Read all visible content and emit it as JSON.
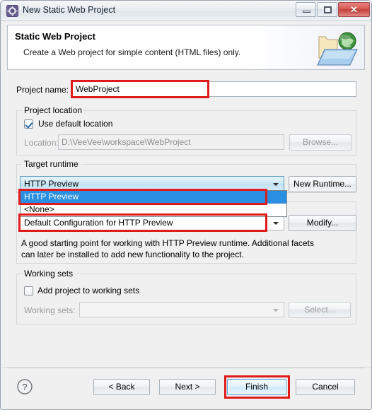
{
  "window": {
    "title": "New Static Web Project",
    "icon": "eclipse-wizard-icon",
    "controls": {
      "minimize": "minimize-button",
      "maximize": "maximize-button",
      "close_glyph": "✕"
    }
  },
  "header": {
    "title": "Static Web Project",
    "description": "Create a Web project for simple content (HTML files) only.",
    "icon": "web-project-folder-globe-icon"
  },
  "project_name": {
    "label": "Project name:",
    "value": "WebProject",
    "placeholder": "",
    "highlighted": true
  },
  "project_location": {
    "group_label": "Project location",
    "use_default_checkbox": {
      "label": "Use default location",
      "checked": true
    },
    "location": {
      "label": "Location:",
      "value": "D:\\VeeVee\\workspace\\WebProject",
      "disabled": true
    },
    "browse_button": "Browse..."
  },
  "target_runtime": {
    "group_label": "Target runtime",
    "selected": "HTTP Preview",
    "open": true,
    "options": [
      {
        "label": "HTTP Preview",
        "selected": true
      },
      {
        "label": "<None>",
        "selected": false
      }
    ],
    "new_runtime_button": "New Runtime...",
    "highlighted": true
  },
  "configuration": {
    "selected": "Default Configuration for HTTP Preview",
    "modify_button": "Modify...",
    "description": "A good starting point for working with HTTP Preview runtime. Additional facets can later be installed to add new functionality to the project.",
    "highlighted": true
  },
  "working_sets": {
    "group_label": "Working sets",
    "add_checkbox": {
      "label": "Add project to working sets",
      "checked": false
    },
    "working_sets_label": "Working sets:",
    "working_sets_value": "",
    "select_button": "Select..."
  },
  "footer": {
    "help_icon": "help-question-icon",
    "back_button": "< Back",
    "next_button": "Next >",
    "finish_button": "Finish",
    "cancel_button": "Cancel",
    "finish_highlighted": true
  },
  "colors": {
    "annotation_red": "#e01b1b",
    "selection_blue": "#2a8fe0",
    "dialog_background": "#f0f0f0",
    "close_button_red": "#c63f3b"
  }
}
